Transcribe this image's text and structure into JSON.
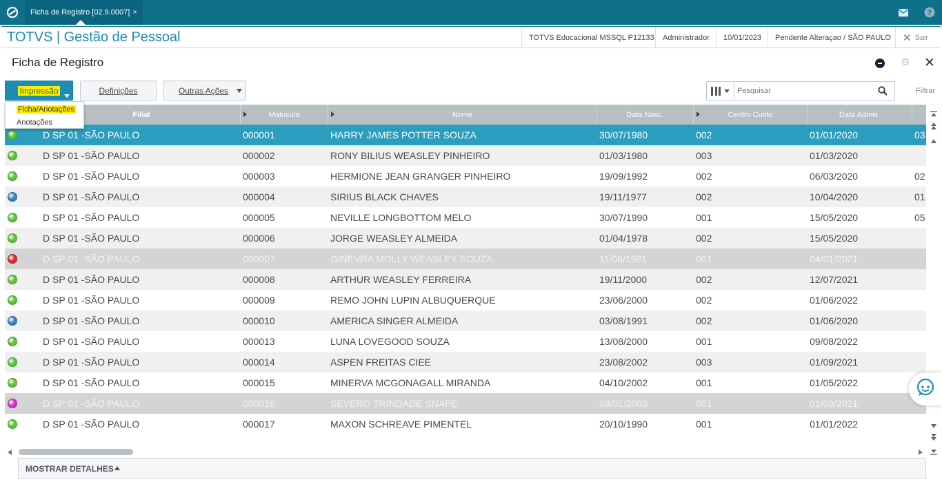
{
  "topbar": {
    "tab_label": "Ficha de Registro [02.9.0007]",
    "tab_close": "×"
  },
  "header": {
    "app_title": "TOTVS | Gestão de Pessoal",
    "environment": "TOTVS Educacional MSSQL P12133",
    "user": "Administrador",
    "date": "10/01/2023",
    "branch": "Pendente Alteraçao / SÃO PAULO",
    "exit_label": "Sair"
  },
  "page": {
    "title": "Ficha de Registro"
  },
  "toolbar": {
    "print_label": "Impressão",
    "definitions_label": "Definições",
    "other_actions_label": "Outras Ações",
    "search_placeholder": "Pesquisar",
    "filter_label": "Filtrar"
  },
  "print_menu": {
    "items": [
      "Ficha/Anotações",
      "Anotações"
    ]
  },
  "grid": {
    "columns": [
      "Filial",
      "Matricula",
      "Nome",
      "Data Nasc.",
      "Centro Custo",
      "Data Admis."
    ],
    "rows": [
      {
        "status": "green",
        "filial": "D SP 01 -SÃO PAULO",
        "matricula": "000001",
        "nome": "HARRY JAMES POTTER SOUZA",
        "nasc": "30/07/1980",
        "cc": "002",
        "admis": "01/01/2020",
        "extra": "03",
        "state": "selected"
      },
      {
        "status": "green",
        "filial": "D SP 01 -SÃO PAULO",
        "matricula": "000002",
        "nome": "RONY BILIUS WEASLEY PINHEIRO",
        "nasc": "01/03/1980",
        "cc": "003",
        "admis": "01/03/2020",
        "extra": "",
        "state": "normal"
      },
      {
        "status": "green",
        "filial": "D SP 01 -SÃO PAULO",
        "matricula": "000003",
        "nome": "HERMIONE JEAN GRANGER PINHEIRO",
        "nasc": "19/09/1992",
        "cc": "002",
        "admis": "06/03/2020",
        "extra": "02",
        "state": "normal"
      },
      {
        "status": "blue",
        "filial": "D SP 01 -SÃO PAULO",
        "matricula": "000004",
        "nome": "SIRIUS BLACK CHAVES",
        "nasc": "19/11/1977",
        "cc": "002",
        "admis": "10/04/2020",
        "extra": "01",
        "state": "normal"
      },
      {
        "status": "green",
        "filial": "D SP 01 -SÃO PAULO",
        "matricula": "000005",
        "nome": "NEVILLE LONGBOTTOM MELO",
        "nasc": "30/07/1990",
        "cc": "001",
        "admis": "15/05/2020",
        "extra": "05",
        "state": "normal"
      },
      {
        "status": "green",
        "filial": "D SP 01 -SÃO PAULO",
        "matricula": "000006",
        "nome": "JORGE WEASLEY ALMEIDA",
        "nasc": "01/04/1978",
        "cc": "002",
        "admis": "15/05/2020",
        "extra": "",
        "state": "normal"
      },
      {
        "status": "red",
        "filial": "D SP 01 -SÃO PAULO",
        "matricula": "000007",
        "nome": "GINEVRA MOLLY WEASLEY SOUZA",
        "nasc": "11/08/1981",
        "cc": "001",
        "admis": "04/01/2021",
        "extra": "",
        "state": "disabled"
      },
      {
        "status": "green",
        "filial": "D SP 01 -SÃO PAULO",
        "matricula": "000008",
        "nome": "ARTHUR WEASLEY FERREIRA",
        "nasc": "19/11/2000",
        "cc": "002",
        "admis": "12/07/2021",
        "extra": "",
        "state": "normal"
      },
      {
        "status": "green",
        "filial": "D SP 01 -SÃO PAULO",
        "matricula": "000009",
        "nome": "REMO JOHN LUPIN ALBUQUERQUE",
        "nasc": "23/06/2000",
        "cc": "002",
        "admis": "01/06/2022",
        "extra": "",
        "state": "normal"
      },
      {
        "status": "blue",
        "filial": "D SP 01 -SÃO PAULO",
        "matricula": "000010",
        "nome": "AMERICA SINGER ALMEIDA",
        "nasc": "03/08/1991",
        "cc": "002",
        "admis": "01/06/2020",
        "extra": "",
        "state": "normal"
      },
      {
        "status": "green",
        "filial": "D SP 01 -SÃO PAULO",
        "matricula": "000013",
        "nome": "LUNA LOVEGOOD SOUZA",
        "nasc": "13/08/2000",
        "cc": "001",
        "admis": "09/08/2022",
        "extra": "",
        "state": "normal"
      },
      {
        "status": "green",
        "filial": "D SP 01 -SÃO PAULO",
        "matricula": "000014",
        "nome": "ASPEN FREITAS CIEE",
        "nasc": "23/08/2002",
        "cc": "003",
        "admis": "01/09/2021",
        "extra": "",
        "state": "normal"
      },
      {
        "status": "green",
        "filial": "D SP 01 -SÃO PAULO",
        "matricula": "000015",
        "nome": "MINERVA MCGONAGALL MIRANDA",
        "nasc": "04/10/2002",
        "cc": "001",
        "admis": "01/05/2022",
        "extra": "",
        "state": "normal"
      },
      {
        "status": "magenta",
        "filial": "D SP 01 -SÃO PAULO",
        "matricula": "000016",
        "nome": "SEVERO TRINDADE SNAPE",
        "nasc": "09/01/2003",
        "cc": "001",
        "admis": "01/09/2021",
        "extra": "",
        "state": "disabled"
      },
      {
        "status": "green",
        "filial": "D SP 01 -SÃO PAULO",
        "matricula": "000017",
        "nome": "MAXON SCHREAVE PIMENTEL",
        "nasc": "20/10/1990",
        "cc": "001",
        "admis": "01/01/2022",
        "extra": "",
        "state": "normal"
      }
    ]
  },
  "footer": {
    "details_label": "MOSTRAR DETALHES"
  },
  "colors": {
    "topbar": "#0f7089",
    "accent": "#1b8db1",
    "selected_row": "#2b9dbf",
    "disabled_row": "#d4d4d4",
    "header_bg": "#b7bfc3",
    "status_green": "#5cc236",
    "status_blue": "#3f7ec6",
    "status_red": "#d92b2b",
    "status_magenta": "#d12fd1"
  }
}
